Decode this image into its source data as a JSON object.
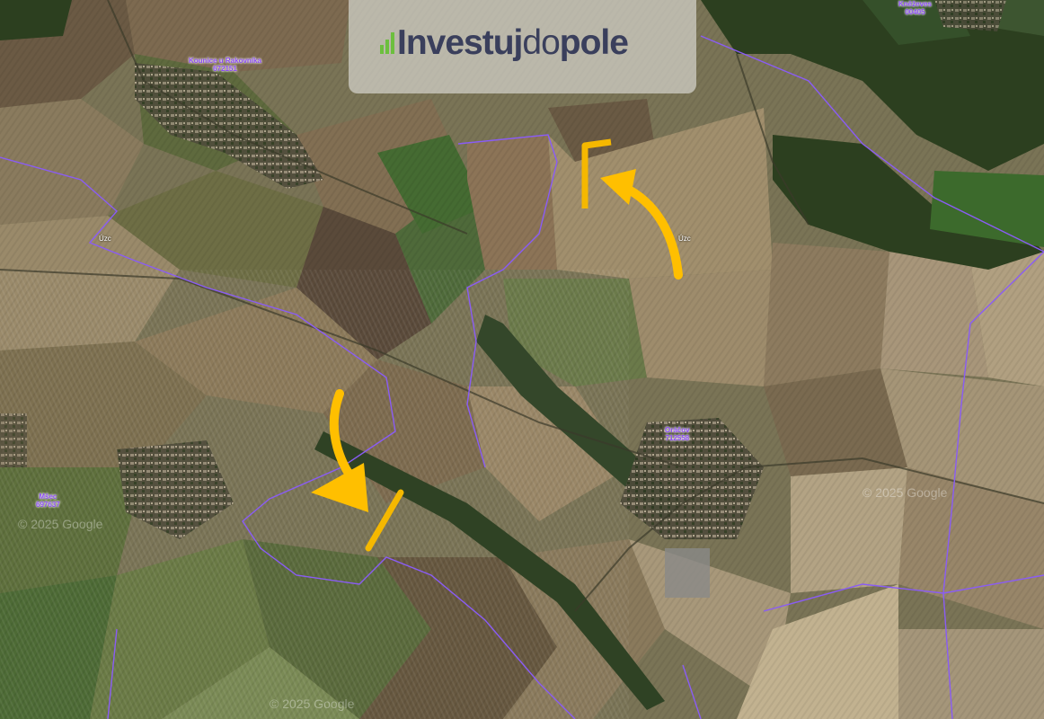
{
  "map": {
    "logo": {
      "part1": "Investuj",
      "part2": "do",
      "part3": "pole"
    },
    "town_labels": [
      {
        "name": "Kounice",
        "line1": "Kounice u Rakovníka",
        "line2": "672151"
      },
      {
        "name": "Kněževes",
        "line1": "Kněževes",
        "line2": "00405"
      },
      {
        "name": "Oráčov",
        "line1": "Oráčov",
        "line2": "712558"
      },
      {
        "name": "Mšecko",
        "line1": "Mšec",
        "line2": "697637"
      }
    ],
    "parcel_tag": "Úzc",
    "watermark": "© 2025 Google",
    "colors": {
      "highlight": "#f5b800",
      "boundary": "#8a5cf5",
      "label": "#8b4bf2"
    },
    "icons": [
      "arrow-icon",
      "parcel-marker"
    ]
  }
}
